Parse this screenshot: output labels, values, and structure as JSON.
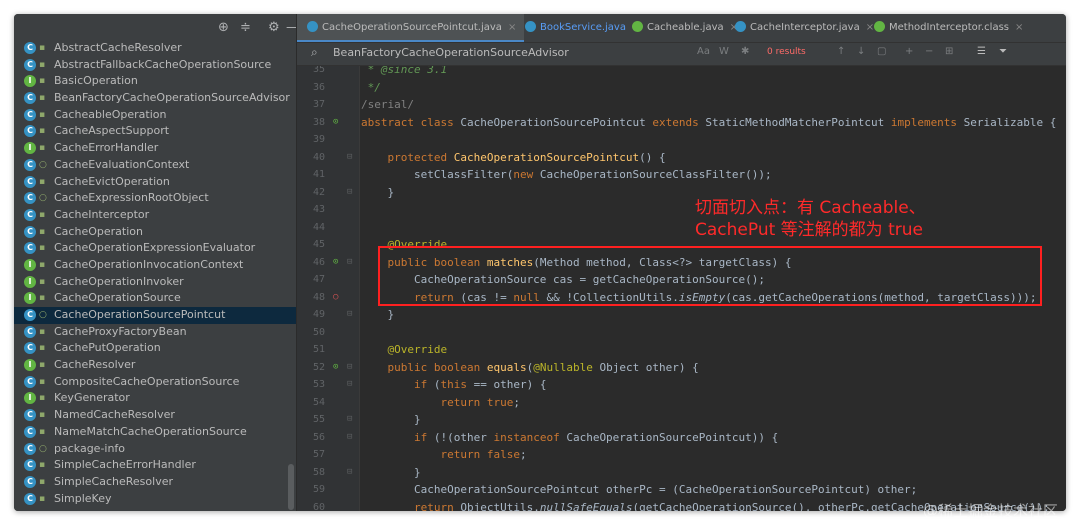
{
  "project": {
    "items": [
      {
        "label": "AbstractCacheResolver",
        "icon": "C"
      },
      {
        "label": "AbstractFallbackCacheOperationSource",
        "icon": "C"
      },
      {
        "label": "BasicOperation",
        "icon": "I"
      },
      {
        "label": "BeanFactoryCacheOperationSourceAdvisor",
        "icon": "C"
      },
      {
        "label": "CacheableOperation",
        "icon": "C"
      },
      {
        "label": "CacheAspectSupport",
        "icon": "C"
      },
      {
        "label": "CacheErrorHandler",
        "icon": "I"
      },
      {
        "label": "CacheEvaluationContext",
        "icon": "C"
      },
      {
        "label": "CacheEvictOperation",
        "icon": "C"
      },
      {
        "label": "CacheExpressionRootObject",
        "icon": "C"
      },
      {
        "label": "CacheInterceptor",
        "icon": "C"
      },
      {
        "label": "CacheOperation",
        "icon": "C"
      },
      {
        "label": "CacheOperationExpressionEvaluator",
        "icon": "C"
      },
      {
        "label": "CacheOperationInvocationContext",
        "icon": "I"
      },
      {
        "label": "CacheOperationInvoker",
        "icon": "I"
      },
      {
        "label": "CacheOperationSource",
        "icon": "I"
      },
      {
        "label": "CacheOperationSourcePointcut",
        "icon": "C"
      },
      {
        "label": "CacheProxyFactoryBean",
        "icon": "C"
      },
      {
        "label": "CachePutOperation",
        "icon": "C"
      },
      {
        "label": "CacheResolver",
        "icon": "I"
      },
      {
        "label": "CompositeCacheOperationSource",
        "icon": "C"
      },
      {
        "label": "KeyGenerator",
        "icon": "I"
      },
      {
        "label": "NamedCacheResolver",
        "icon": "C"
      },
      {
        "label": "NameMatchCacheOperationSource",
        "icon": "C"
      },
      {
        "label": "package-info",
        "icon": "C"
      },
      {
        "label": "SimpleCacheErrorHandler",
        "icon": "C"
      },
      {
        "label": "SimpleCacheResolver",
        "icon": "C"
      },
      {
        "label": "SimpleKey",
        "icon": "C"
      }
    ],
    "selected_index": 16
  },
  "tabs": [
    {
      "label": "CacheOperationSourcePointcut.java",
      "active": true
    },
    {
      "label": "BookService.java",
      "active": false
    },
    {
      "label": "Cacheable.java",
      "active": false
    },
    {
      "label": "CacheInterceptor.java",
      "active": false
    },
    {
      "label": "MethodInterceptor.class",
      "active": false
    }
  ],
  "search": {
    "query": "BeanFactoryCacheOperationSourceAdvisor",
    "results": "0 results",
    "match_case": "Aa",
    "words": "W"
  },
  "code_lines": [
    {
      "n": "35",
      "html": " <span class=\"cm\">* @since 3.1</span>"
    },
    {
      "n": "36",
      "html": " <span class=\"cm\">*/</span>"
    },
    {
      "n": "37",
      "html": "<span class=\"cmt-grey\">/serial/</span>"
    },
    {
      "n": "38",
      "html": "<span class=\"kw\">abstract class</span> CacheOperationSourcePointcut <span class=\"kw\">extends</span> StaticMethodMatcherPointcut <span class=\"kw\">implements</span> Serializable {"
    },
    {
      "n": "39",
      "html": ""
    },
    {
      "n": "40",
      "html": "    <span class=\"kw\">protected</span> <span class=\"fn\">CacheOperationSourcePointcut</span>() {"
    },
    {
      "n": "41",
      "html": "        setClassFilter(<span class=\"kw\">new</span> CacheOperationSourceClassFilter());"
    },
    {
      "n": "42",
      "html": "    }"
    },
    {
      "n": "43",
      "html": ""
    },
    {
      "n": "44",
      "html": ""
    },
    {
      "n": "45",
      "html": "    <span class=\"ann\">@Override</span>"
    },
    {
      "n": "46",
      "html": "    <span class=\"kw\">public boolean</span> <span class=\"fn\">matches</span>(Method method, Class&lt;?&gt; targetClass) {"
    },
    {
      "n": "47",
      "html": "        CacheOperationSource cas = getCacheOperationSource();"
    },
    {
      "n": "48",
      "html": "        <span class=\"kw\">return</span> (cas != <span class=\"kw\">null</span> &amp;&amp; !CollectionUtils.<span class=\"it\">isEmpty</span>(cas.getCacheOperations(method, targetClass)));"
    },
    {
      "n": "49",
      "html": "    }"
    },
    {
      "n": "50",
      "html": ""
    },
    {
      "n": "51",
      "html": "    <span class=\"ann\">@Override</span>"
    },
    {
      "n": "52",
      "html": "    <span class=\"kw\">public boolean</span> <span class=\"fn\">equals</span>(<span class=\"ann\">@Nullable</span> Object other) {"
    },
    {
      "n": "53",
      "html": "        <span class=\"kw\">if</span> (<span class=\"kw\">this</span> == other) {"
    },
    {
      "n": "54",
      "html": "            <span class=\"kw\">return true</span>;"
    },
    {
      "n": "55",
      "html": "        }"
    },
    {
      "n": "56",
      "html": "        <span class=\"kw\">if</span> (!(other <span class=\"kw\">instanceof</span> CacheOperationSourcePointcut)) {"
    },
    {
      "n": "57",
      "html": "            <span class=\"kw\">return false</span>;"
    },
    {
      "n": "58",
      "html": "        }"
    },
    {
      "n": "59",
      "html": "        CacheOperationSourcePointcut otherPc = (CacheOperationSourcePointcut) other;"
    },
    {
      "n": "60",
      "html": "        <span class=\"kw\">return</span> ObjectUtils.<span class=\"it\">nullSafeEquals</span>(getCacheOperationSource(), otherPc.getCacheOperationSource());"
    }
  ],
  "annotation_note": {
    "line1": "切面切入点：有 Cacheable、",
    "line2": "CachePut 等注解的都为 true"
  },
  "watermark": "@稀土掘金技术社区"
}
